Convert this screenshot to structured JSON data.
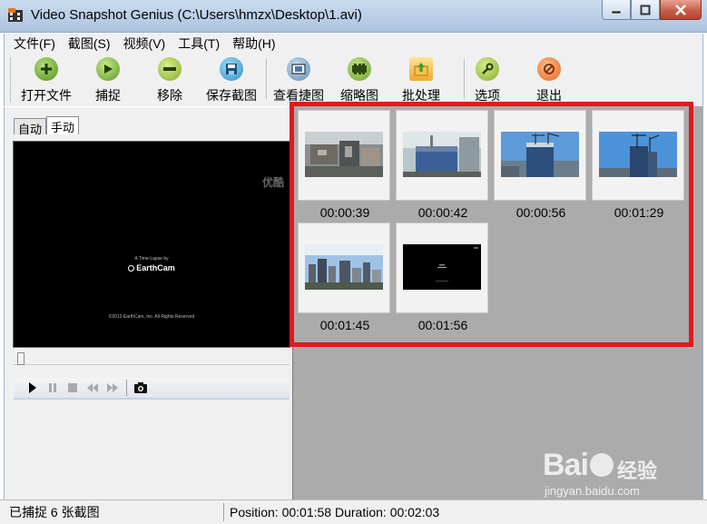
{
  "window": {
    "title": "Video Snapshot Genius (C:\\Users\\hmzx\\Desktop\\1.avi)"
  },
  "menu": [
    "文件(F)",
    "截图(S)",
    "视频(V)",
    "工具(T)",
    "帮助(H)"
  ],
  "toolbar": {
    "open": "打开文件",
    "capture": "捕捉",
    "remove": "移除",
    "save": "保存截图",
    "view": "查看捷图",
    "thumbnail": "缩略图",
    "batch": "批处理",
    "options": "选项",
    "exit": "退出"
  },
  "tabs": [
    "自动",
    "手动"
  ],
  "video": {
    "watermark": "优酷",
    "intro": "A Time-Lapse by",
    "logo": "EarthCam",
    "copyright": "©2012 EarthCam, Inc. All Rights Reserved"
  },
  "snapshots": [
    {
      "time": "00:00:39",
      "scene": "construction-site"
    },
    {
      "time": "00:00:42",
      "scene": "tower-base"
    },
    {
      "time": "00:00:56",
      "scene": "tower-cranes"
    },
    {
      "time": "00:01:29",
      "scene": "tower-sky"
    },
    {
      "time": "00:01:45",
      "scene": "city-skyline"
    },
    {
      "time": "00:01:56",
      "scene": "black-title"
    }
  ],
  "status": {
    "captured": "已捕捉 6 张截图",
    "position_label": "Position:",
    "position": "00:01:58",
    "duration_label": "Duration:",
    "duration": "00:02:03"
  },
  "watermark": {
    "brand": "Bai",
    "suffix": "经验",
    "url": "jingyan.baidu.com"
  },
  "colors": {
    "highlight": "#e0191f",
    "titlebar": "#b9cde6",
    "thumbsBg": "#ababab"
  }
}
